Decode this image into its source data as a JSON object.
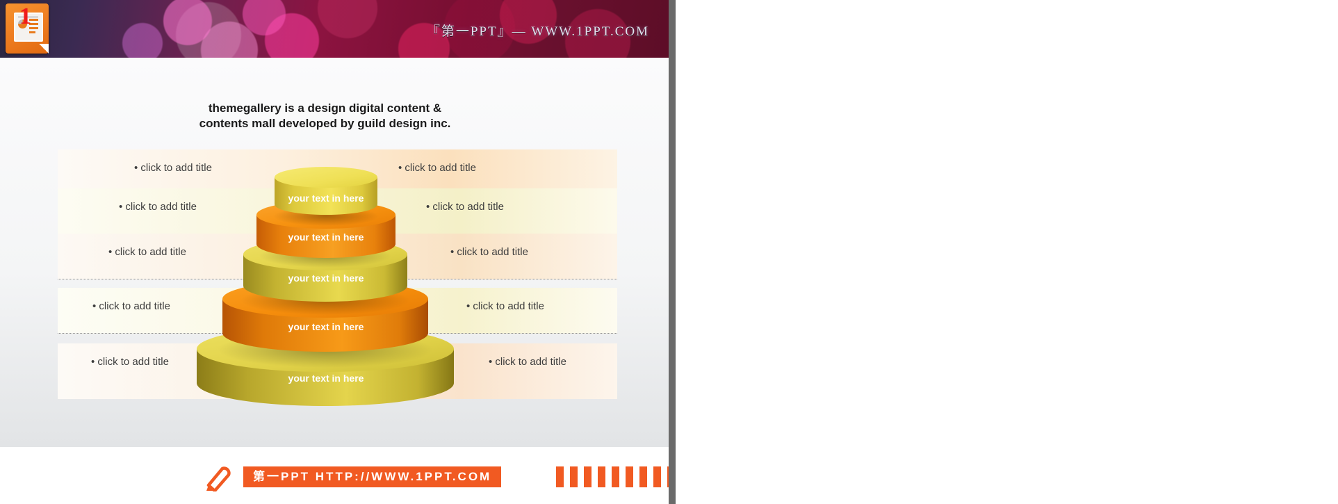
{
  "header": {
    "title": "『第一PPT』— WWW.1PPT.COM",
    "logo_number": "1",
    "logo_icon": "powerpoint-document-icon"
  },
  "slide": {
    "title_line1": "themegallery is a design digital content &",
    "title_line2": "contents mall developed by guild design inc.",
    "rows": [
      {
        "left": "• click to add title",
        "right": "• click to add title"
      },
      {
        "left": "• click to add title",
        "right": "• click to add title"
      },
      {
        "left": "• click to add title",
        "right": "• click to add title"
      },
      {
        "left": "• click to add title",
        "right": "• click to add title"
      },
      {
        "left": "• click to add title",
        "right": "• click to add title"
      }
    ],
    "stack": [
      {
        "label": "your text in here",
        "color": "#e8d84a",
        "level": 1
      },
      {
        "label": "your text in here",
        "color": "#f08c0a",
        "level": 2
      },
      {
        "label": "your text in here",
        "color": "#d9cf3e",
        "level": 3
      },
      {
        "label": "your text in here",
        "color": "#f07d0a",
        "level": 4
      },
      {
        "label": "your text in here",
        "color": "#d8ce3a",
        "level": 5
      }
    ]
  },
  "footer": {
    "banner_text": "第一PPT HTTP://WWW.1PPT.COM",
    "accent_color": "#f15a22",
    "pencil_icon": "pencil-icon",
    "stripe_count": 12
  }
}
